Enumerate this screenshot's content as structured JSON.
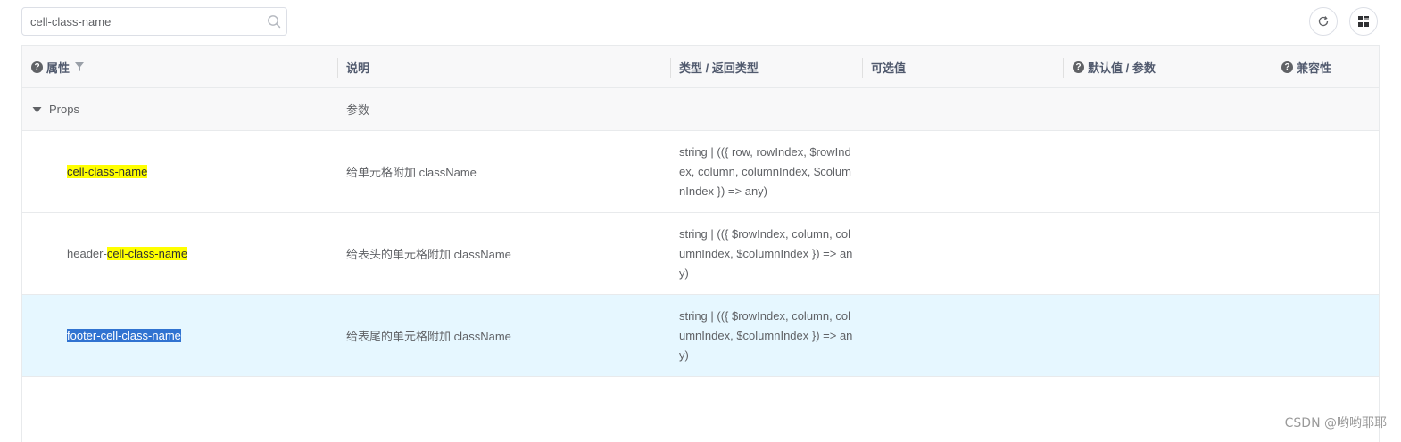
{
  "search": {
    "value": "cell-class-name"
  },
  "headers": {
    "attr": "属性",
    "desc": "说明",
    "type": "类型 / 返回类型",
    "options": "可选值",
    "default": "默认值 / 参数",
    "compat": "兼容性"
  },
  "group": {
    "name": "Props",
    "desc": "参数"
  },
  "rows": [
    {
      "name_pre": "",
      "name_hl": "cell-class-name",
      "desc": "给单元格附加 className",
      "type": "string | (({ row, rowIndex, $rowIndex, column, columnIndex, $columnIndex }) => any)"
    },
    {
      "name_pre": "header-",
      "name_hl": "cell-class-name",
      "desc": "给表头的单元格附加 className",
      "type": "string | (({ $rowIndex, column, columnIndex, $columnIndex }) => any)"
    },
    {
      "name_pre": "footer-",
      "name_hl": "cell-class-name",
      "desc": "给表尾的单元格附加 className",
      "type": "string | (({ $rowIndex, column, columnIndex, $columnIndex }) => any)"
    }
  ],
  "watermark": "CSDN @哟哟耶耶",
  "icons": {
    "search": "search-icon",
    "refresh": "refresh-icon",
    "grid": "grid-icon",
    "filter": "filter-icon",
    "help": "help-circle-icon",
    "expand": "caret-down-icon"
  },
  "colors": {
    "highlight": "#ffff00",
    "selection": "#3073d1",
    "selected_row": "#e6f7ff",
    "header_bg": "#f8f8f9"
  }
}
